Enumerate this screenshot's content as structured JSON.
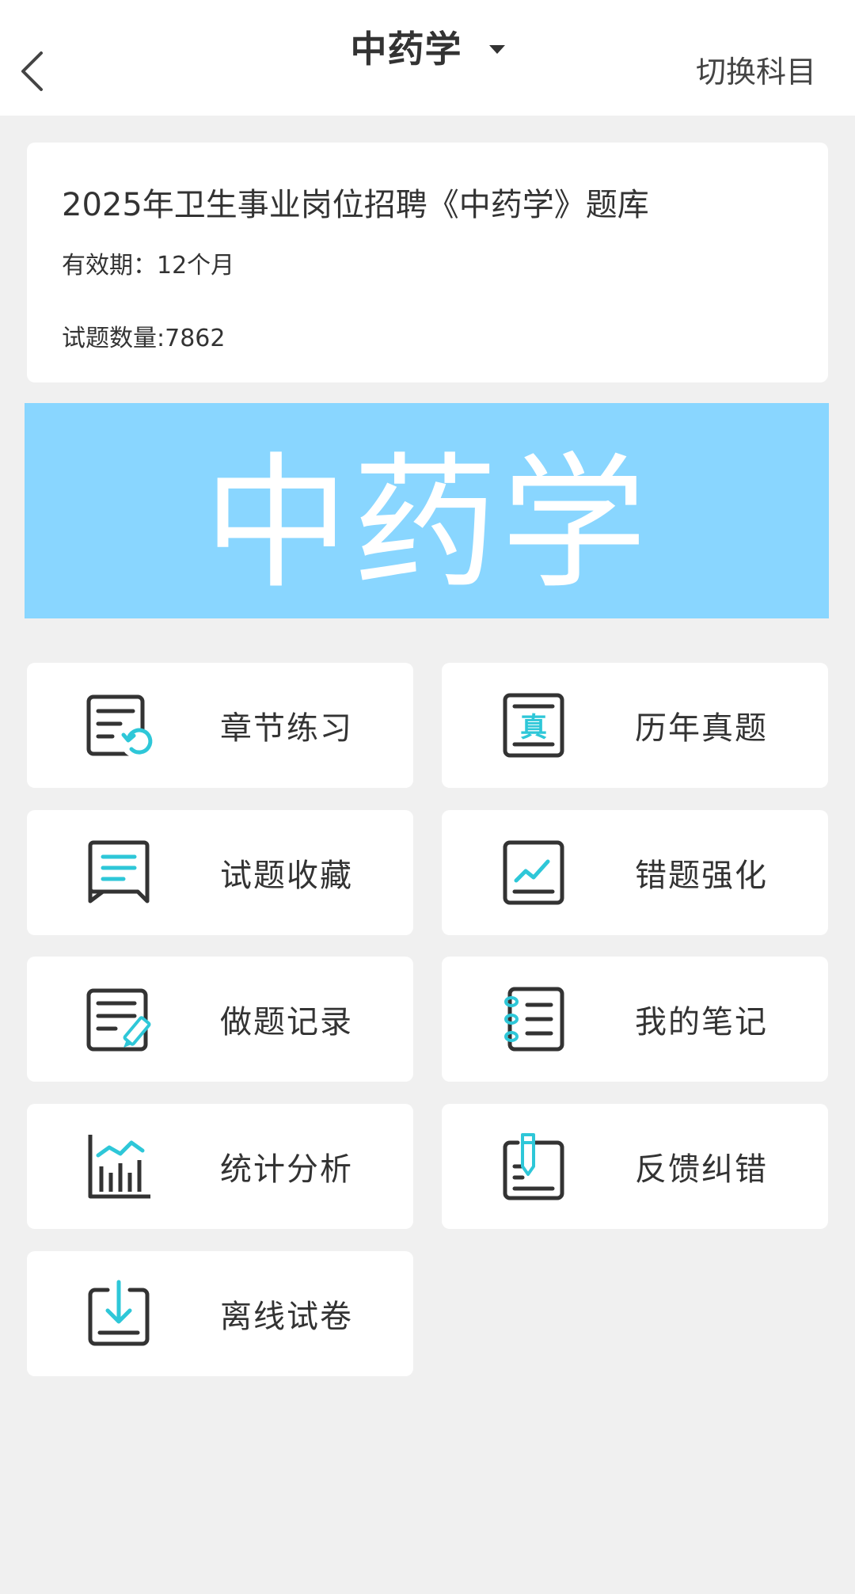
{
  "header": {
    "title": "中药学",
    "switch_label": "切换科目"
  },
  "info": {
    "title": "2025年卫生事业岗位招聘《中药学》题库",
    "validity": "有效期：12个月",
    "count": "试题数量:7862"
  },
  "banner": {
    "text": "中药学",
    "color": "#89d6ff"
  },
  "accent_color": "#2ec7d8",
  "tiles": [
    {
      "label": "章节练习",
      "icon": "chapter-practice-icon"
    },
    {
      "label": "历年真题",
      "icon": "past-papers-icon",
      "icon_glyph": "真"
    },
    {
      "label": "试题收藏",
      "icon": "favorites-icon"
    },
    {
      "label": "错题强化",
      "icon": "mistakes-icon"
    },
    {
      "label": "做题记录",
      "icon": "history-record-icon"
    },
    {
      "label": "我的笔记",
      "icon": "notebook-icon"
    },
    {
      "label": "统计分析",
      "icon": "statistics-icon"
    },
    {
      "label": "反馈纠错",
      "icon": "feedback-icon"
    },
    {
      "label": "离线试卷",
      "icon": "offline-download-icon"
    }
  ]
}
